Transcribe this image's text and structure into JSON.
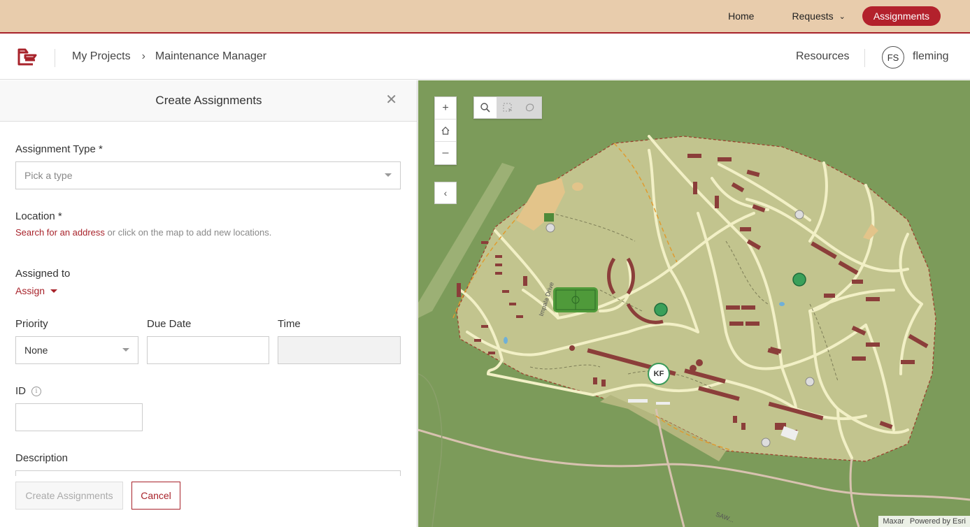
{
  "top_nav": {
    "home": "Home",
    "requests": "Requests",
    "assignments": "Assignments"
  },
  "header": {
    "breadcrumb_root": "My Projects",
    "breadcrumb_current": "Maintenance Manager",
    "resources": "Resources",
    "avatar_initials": "FS",
    "username": "fleming"
  },
  "panel": {
    "title": "Create Assignments",
    "assignment_type_label": "Assignment Type  *",
    "assignment_type_placeholder": "Pick a type",
    "location_label": "Location *",
    "location_link": "Search for an address",
    "location_hint": " or click on the map to add new locations.",
    "assigned_to_label": "Assigned to",
    "assign_link": "Assign",
    "priority_label": "Priority",
    "priority_value": "None",
    "due_date_label": "Due Date",
    "time_label": "Time",
    "id_label": "ID",
    "description_label": "Description",
    "create_button": "Create Assignments",
    "cancel_button": "Cancel"
  },
  "map": {
    "marker_kf": "KF",
    "road_label_1": "Impala Drive",
    "road_label_2": "SAW...",
    "attribution_1": "Maxar",
    "attribution_2": "Powered by Esri"
  },
  "colors": {
    "accent": "#a8232b",
    "topbar": "#e8ccac"
  }
}
